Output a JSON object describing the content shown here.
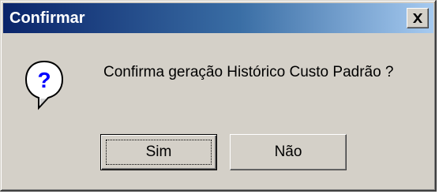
{
  "dialog": {
    "title": "Confirmar",
    "message": "Confirma geração Histórico Custo Padrão ?",
    "icon": "question-icon",
    "close_icon": "close-icon"
  },
  "buttons": {
    "yes_label": "Sim",
    "no_label": "Não",
    "default": "yes"
  },
  "colors": {
    "title_bar_start": "#0a246a",
    "title_bar_end": "#a6caf0",
    "face": "#d4d0c8",
    "icon_fill": "#ffffff",
    "icon_glyph": "#0000ff"
  }
}
